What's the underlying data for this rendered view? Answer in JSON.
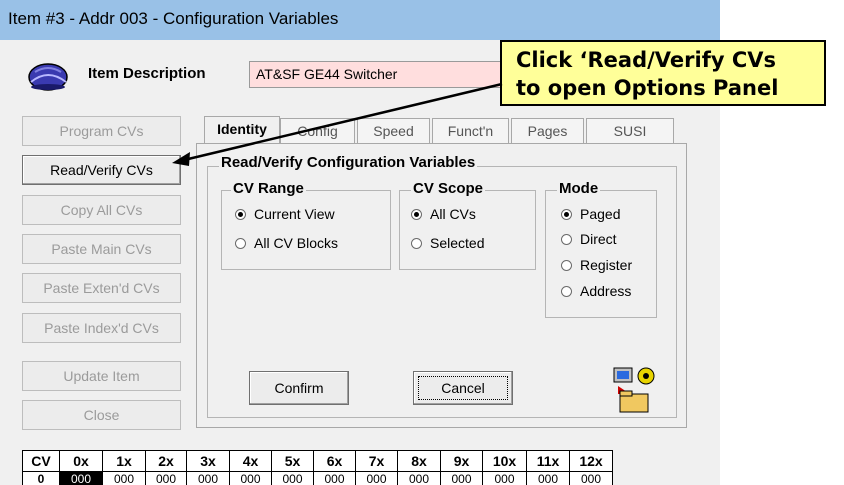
{
  "window": {
    "title": "Item #3 - Addr 003 - Configuration Variables"
  },
  "header": {
    "item_desc_label": "Item Description",
    "desc_value": "AT&SF GE44 Switcher"
  },
  "left_buttons": [
    {
      "label": "Program CVs",
      "enabled": false
    },
    {
      "label": "Read/Verify CVs",
      "enabled": true
    },
    {
      "label": "Copy All CVs",
      "enabled": false
    },
    {
      "label": "Paste Main CVs",
      "enabled": false
    },
    {
      "label": "Paste Exten'd CVs",
      "enabled": false
    },
    {
      "label": "Paste Index'd CVs",
      "enabled": false
    },
    {
      "label": "Update Item",
      "enabled": false
    },
    {
      "label": "Close",
      "enabled": false
    }
  ],
  "tabs": [
    {
      "label": "Identity",
      "selected": true
    },
    {
      "label": "Config"
    },
    {
      "label": "Speed"
    },
    {
      "label": "Funct'n"
    },
    {
      "label": "Pages"
    },
    {
      "label": "SUSI"
    }
  ],
  "panel": {
    "title": "Read/Verify Configuration Variables",
    "cv_range": {
      "title": "CV Range",
      "options": [
        "Current View",
        "All CV Blocks"
      ],
      "selected": "Current View"
    },
    "cv_scope": {
      "title": "CV Scope",
      "options": [
        "All CVs",
        "Selected"
      ],
      "selected": "All CVs"
    },
    "mode": {
      "title": "Mode",
      "options": [
        "Paged",
        "Direct",
        "Register",
        "Address"
      ],
      "selected": "Paged"
    },
    "confirm_label": "Confirm",
    "cancel_label": "Cancel"
  },
  "cv_table": {
    "headers": [
      "CV",
      "0x",
      "1x",
      "2x",
      "3x",
      "4x",
      "5x",
      "6x",
      "7x",
      "8x",
      "9x",
      "10x",
      "11x",
      "12x"
    ],
    "row_label": "0",
    "values": [
      "000",
      "000",
      "000",
      "000",
      "000",
      "000",
      "000",
      "000",
      "000",
      "000",
      "000",
      "000",
      "000"
    ]
  },
  "callout": {
    "line1": "Click ‘Read/Verify CVs",
    "line2": "to open Options Panel"
  },
  "colors": {
    "title_bar": "#99c1e7",
    "callout_bg": "#ffff99",
    "desc_bg": "#ffdede"
  }
}
